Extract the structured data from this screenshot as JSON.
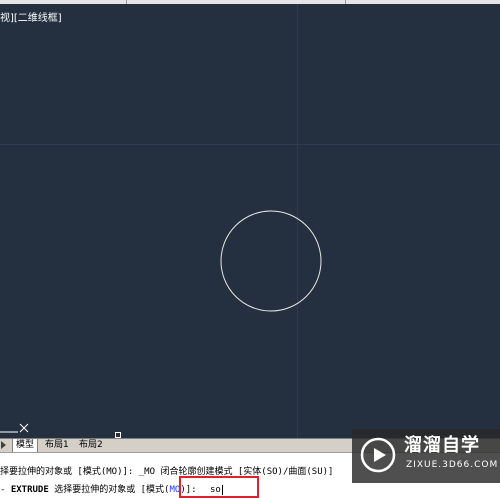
{
  "viewport": {
    "label": "视][二维线框]"
  },
  "tabs": {
    "items": [
      {
        "label": "模型"
      },
      {
        "label": "布局1"
      },
      {
        "label": "布局2"
      }
    ]
  },
  "command": {
    "history_line": "择要拉伸的对象或 [模式(MO)]: _MO 闭合轮廓创建模式 [实体(SO)/曲面(SU)]",
    "prompt_prefix": "- ",
    "prompt_command": "EXTRUDE",
    "prompt_text_a": " 选择要拉伸的对象或 [模式(",
    "prompt_mo": "MO",
    "prompt_text_b": ")]: ",
    "input_value": "so"
  },
  "watermark": {
    "title": "溜溜自学",
    "subtitle": "ZIXUE.3D66.COM",
    "icon": "play-logo-icon"
  },
  "colors": {
    "canvas_bg": "#243040",
    "highlight_box": "#e0202a",
    "mo_highlight": "#1a3cff"
  }
}
